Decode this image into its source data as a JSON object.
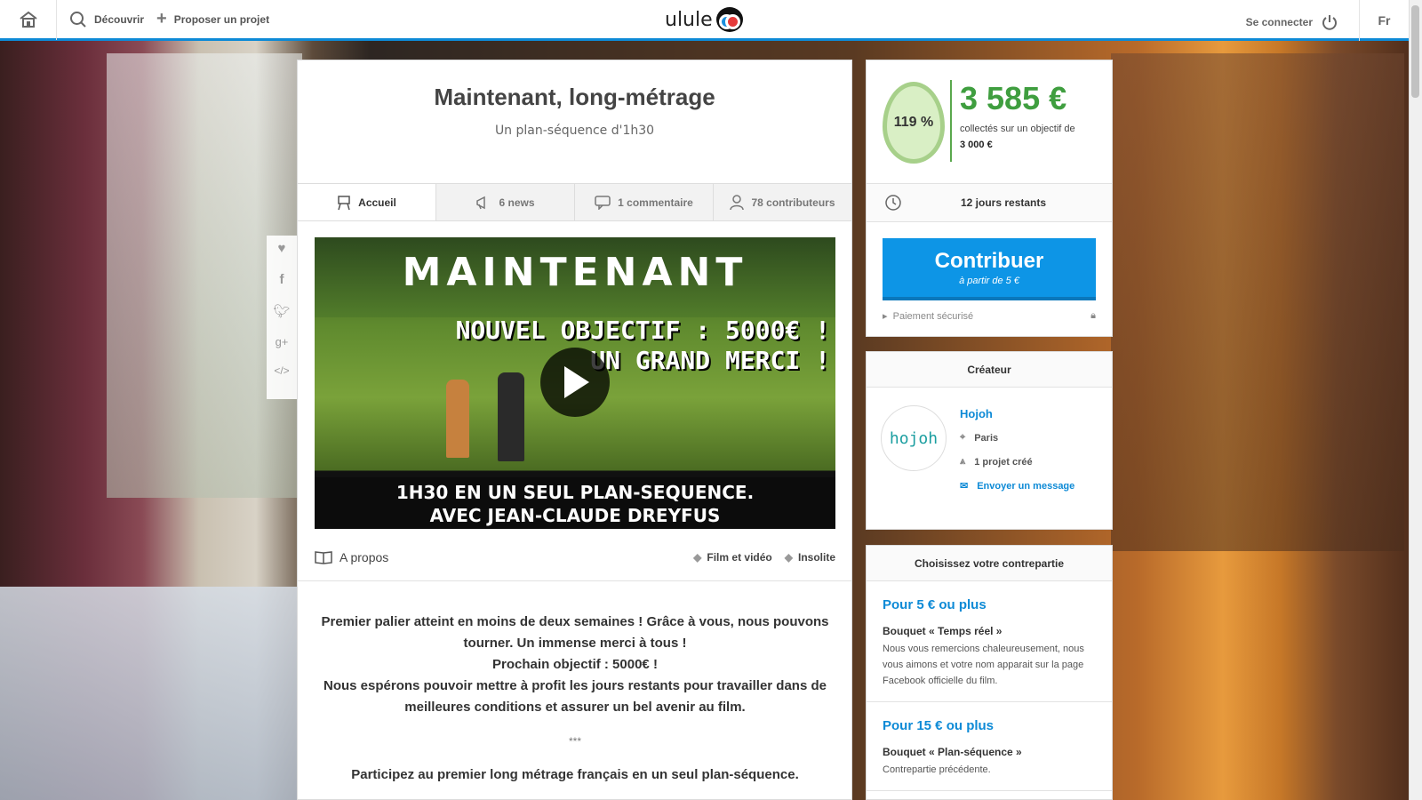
{
  "header": {
    "discover": "Découvrir",
    "propose": "Proposer un projet",
    "logo": "ulule",
    "login": "Se connecter",
    "lang": "Fr"
  },
  "project": {
    "title": "Maintenant, long-métrage",
    "subtitle": "Un plan-séquence d'1h30"
  },
  "tabs": [
    {
      "label": "Accueil",
      "icon": "easel-icon"
    },
    {
      "label": "6 news",
      "icon": "megaphone-icon"
    },
    {
      "label": "1 commentaire",
      "icon": "comment-icon"
    },
    {
      "label": "78 contributeurs",
      "icon": "user-icon"
    }
  ],
  "video": {
    "title": "MAINTENANT",
    "line1": "NOUVEL OBJECTIF : 5000€ !",
    "line2": "UN GRAND MERCI !",
    "bottom1": "1H30 EN UN SEUL PLAN-SEQUENCE.",
    "bottom2": "AVEC JEAN-CLAUDE DREYFUS"
  },
  "about": {
    "label": "A propos",
    "tags": [
      "Film et vidéo",
      "Insolite"
    ]
  },
  "description": {
    "p1": "Premier palier atteint en moins de deux semaines ! Grâce à vous, nous pouvons tourner. Un immense merci à tous !",
    "p2": "Prochain objectif : 5000€ !",
    "p3": "Nous espérons pouvoir mettre à profit les jours restants pour travailler dans de meilleures conditions et assurer un bel avenir au film.",
    "stars": "***",
    "p4": "Participez au premier long métrage français en un seul plan-séquence."
  },
  "funding": {
    "percent": "119 %",
    "amount": "3 585 €",
    "goal_text": "collectés sur un objectif de",
    "goal": "3 000 €",
    "days_left": "12 jours restants",
    "cta": "Contribuer",
    "cta_sub": "à partir de 5 €",
    "secure": "Paiement sécurisé"
  },
  "creator": {
    "heading": "Créateur",
    "avatar_text": "hojoh",
    "name": "Hojoh",
    "city": "Paris",
    "projects": "1 projet créé",
    "message": "Envoyer un message"
  },
  "rewards": {
    "heading": "Choisissez votre contrepartie",
    "items": [
      {
        "price": "Pour 5 € ou plus",
        "name": "Bouquet « Temps réel »",
        "desc": "Nous vous remercions chaleureusement, nous vous aimons et votre nom apparait sur la page Facebook officielle du film."
      },
      {
        "price": "Pour 15 € ou plus",
        "name": "Bouquet « Plan-séquence »",
        "desc": "Contrepartie précédente."
      }
    ]
  },
  "colors": {
    "accent": "#0d8ad6",
    "success": "#3f9e3f",
    "cta": "#0d95e6"
  }
}
